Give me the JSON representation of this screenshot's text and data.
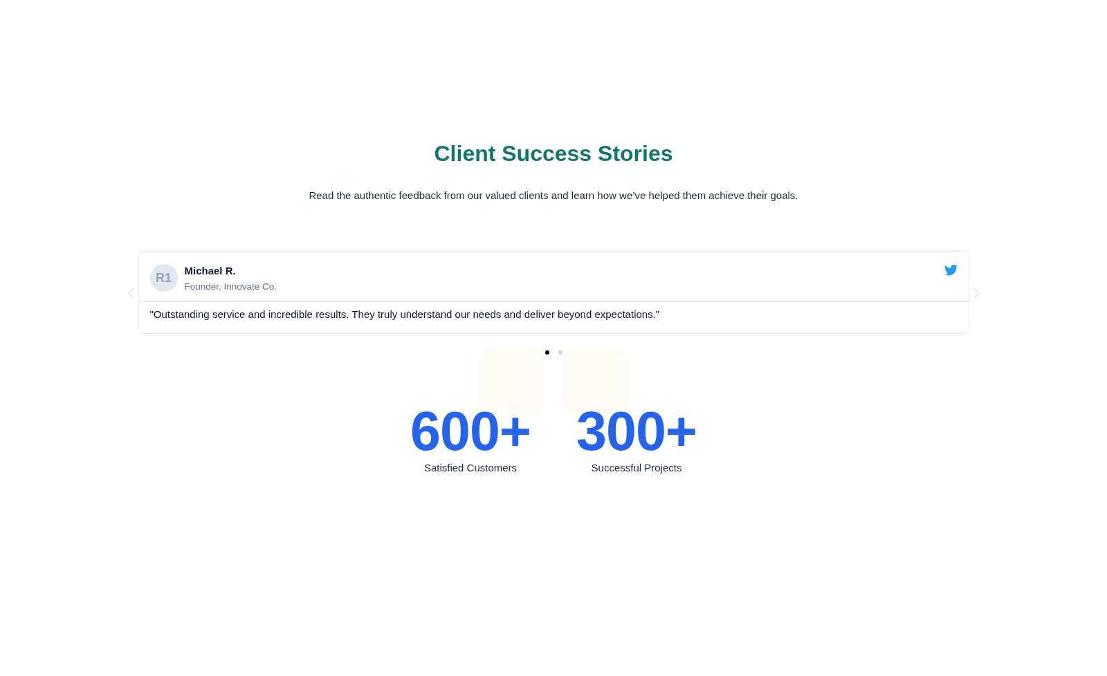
{
  "section": {
    "title": "Client Success Stories",
    "subtitle": "Read the authentic feedback from our valued clients and learn how we’ve helped them achieve their goals."
  },
  "carousel": {
    "testimonials": [
      {
        "initials": "R1",
        "name": "Michael R.",
        "role": "Founder, Innovate Co.",
        "quote": "\"Outstanding service and incredible results. They truly understand our needs and deliver beyond expectations.\""
      }
    ],
    "dots": [
      {
        "selected": true
      },
      {
        "selected": false
      }
    ]
  },
  "stats": [
    {
      "value": "600+",
      "label": "Satisfied Customers"
    },
    {
      "value": "300+",
      "label": "Successful Projects"
    }
  ]
}
